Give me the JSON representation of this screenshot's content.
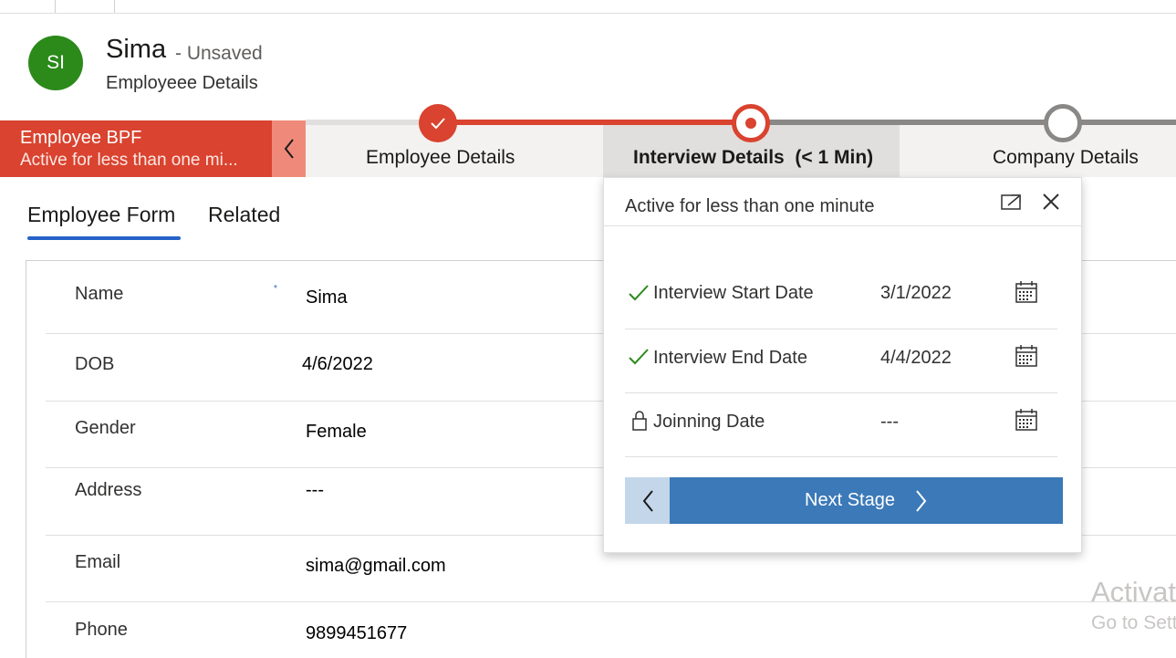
{
  "record": {
    "avatar_initials": "SI",
    "name": "Sima",
    "status": "- Unsaved",
    "entity": "Employeee Details"
  },
  "bpf": {
    "process_name": "Employee BPF",
    "process_status": "Active for less than one mi...",
    "stages": [
      {
        "label": "Employee Details",
        "state": "completed"
      },
      {
        "label": "Interview Details  (< 1 Min)",
        "state": "active"
      },
      {
        "label": "Company Details",
        "state": "upcoming"
      }
    ]
  },
  "tabs": [
    {
      "label": "Employee Form",
      "selected": true
    },
    {
      "label": "Related",
      "selected": false
    }
  ],
  "form": {
    "fields": [
      {
        "label": "Name",
        "value": "Sima"
      },
      {
        "label": "DOB",
        "value": "4/6/2022"
      },
      {
        "label": "Gender",
        "value": "Female"
      },
      {
        "label": "Address",
        "value": "---"
      },
      {
        "label": "Email",
        "value": "sima@gmail.com"
      },
      {
        "label": "Phone",
        "value": "9899451677"
      }
    ],
    "required_marker": "*"
  },
  "popup": {
    "title": "Active for less than one minute",
    "steps": [
      {
        "label": "Interview Start Date",
        "value": "3/1/2022",
        "status_icon": "check-icon"
      },
      {
        "label": "Interview End Date",
        "value": "4/4/2022",
        "status_icon": "check-icon"
      },
      {
        "label": "Joinning Date",
        "value": "---",
        "status_icon": "lock-icon"
      }
    ],
    "next_label": "Next Stage"
  },
  "watermark": {
    "line1": "Activate",
    "line2": "Go to Settings"
  },
  "colors": {
    "accent_red": "#d9432f",
    "avatar_green": "#2b8a1a",
    "primary_blue": "#3b79b8",
    "tab_underline": "#2563c9"
  }
}
